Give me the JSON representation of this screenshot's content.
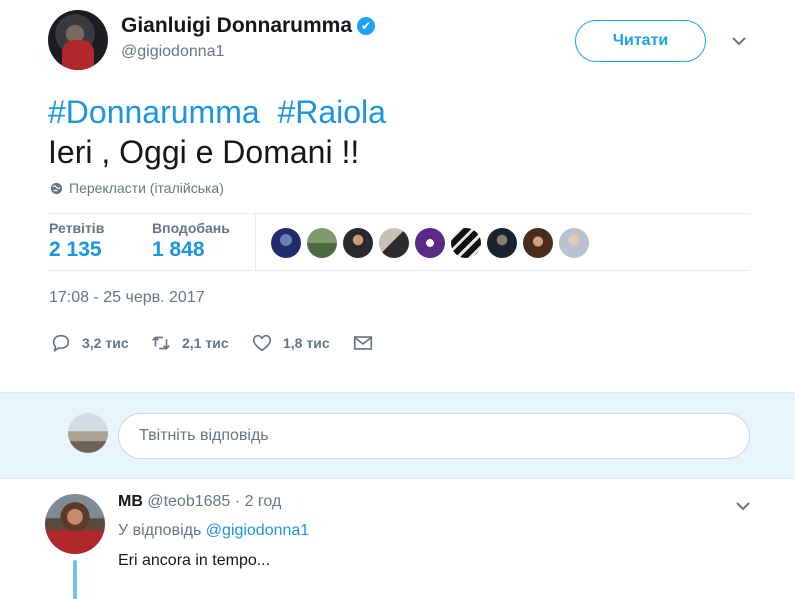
{
  "tweet": {
    "author_name": "Gianluigi Donnarumma",
    "verified_icon": "verified-badge-icon",
    "author_handle": "@gigiodonna1",
    "follow_label": "Читати",
    "hashtag1": "#Donnarumma",
    "hashtag2": "#Raiola",
    "text_line2": "Ieri , Oggi e Domani !!",
    "translate_label": "Перекласти (італійська)",
    "retweets_label": "Ретвітів",
    "retweets_count": "2 135",
    "likes_label": "Вподобань",
    "likes_count": "1 848",
    "timestamp": "17:08 - 25 черв. 2017",
    "actions": {
      "reply_count": "3,2 тис",
      "retweet_count": "2,1 тис",
      "like_count": "1,8 тис"
    }
  },
  "reply_box": {
    "placeholder": "Твітніть відповідь"
  },
  "reply": {
    "name": "MB",
    "handle": "@teob1685",
    "separator": "·",
    "time": "2 год",
    "reply_to_prefix": "У відповідь",
    "reply_to_handle": "@gigiodonna1",
    "text": "Eri ancora in tempo..."
  },
  "colors": {
    "accent": "#1da1f2",
    "link": "#1b95e0",
    "muted": "#657786",
    "reply_bg": "#e8f5fd"
  }
}
